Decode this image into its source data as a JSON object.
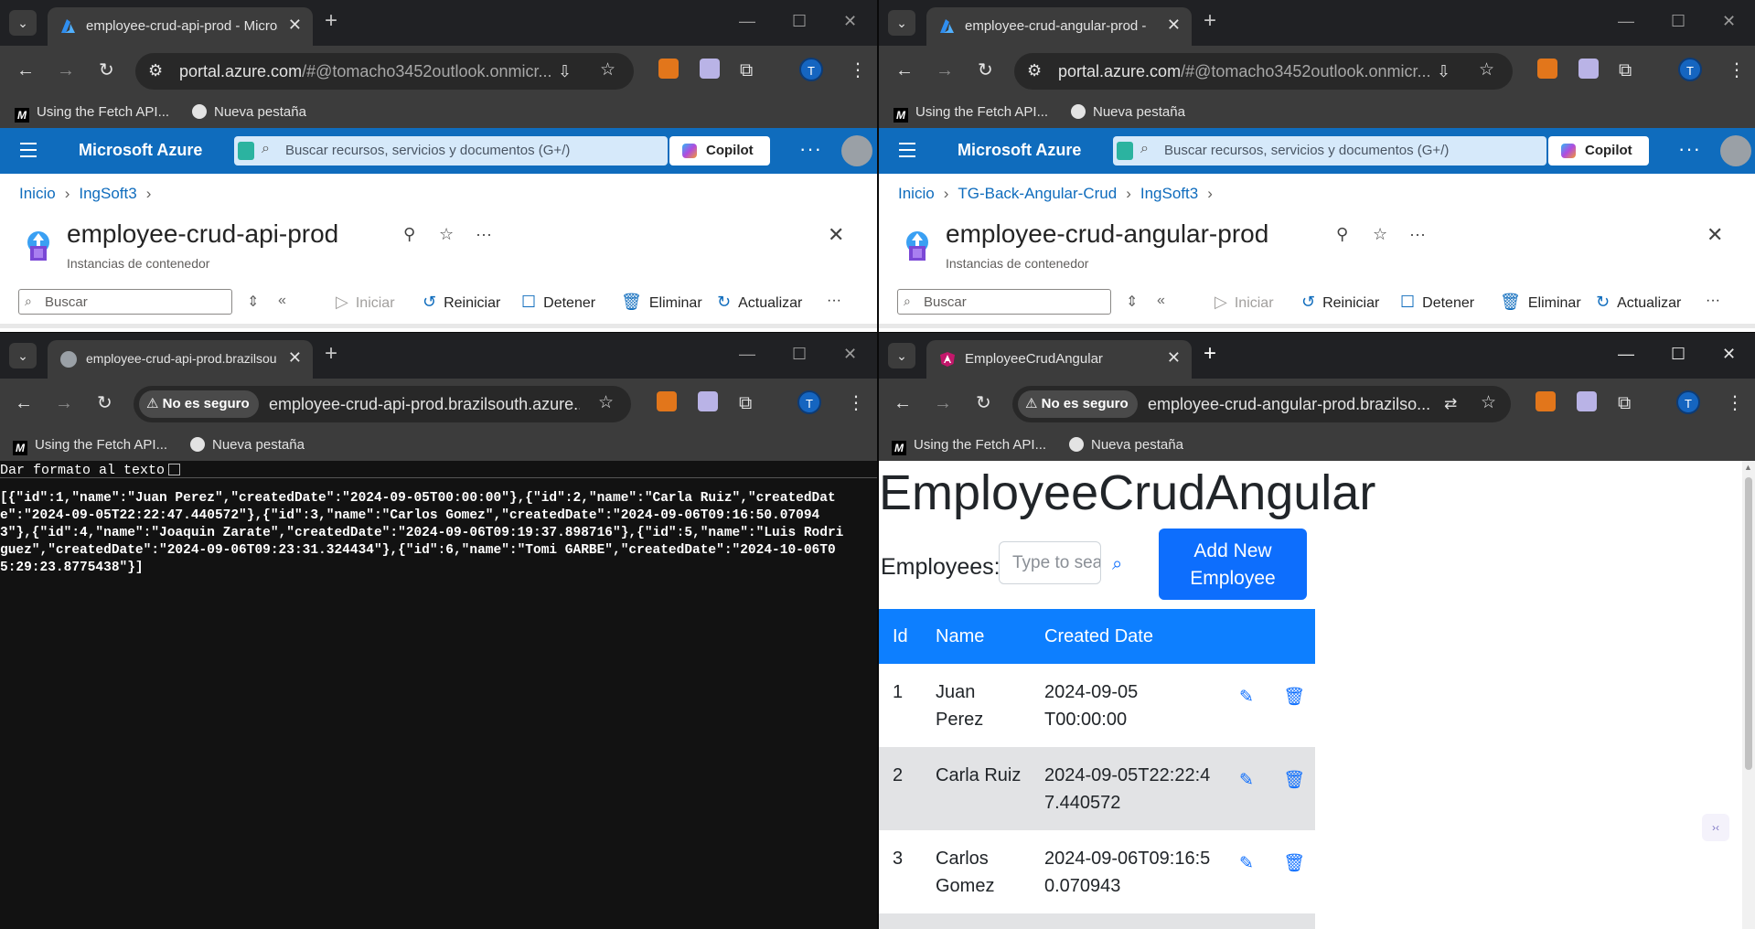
{
  "windows": {
    "w1": {
      "tab_title": "employee-crud-api-prod - Microsoft Azure",
      "url_domain": "portal.azure.com",
      "url_rest": "/#@tomacho3452outlook.onmicr...",
      "bookmarks": [
        "Using the Fetch API...",
        "Nueva pestaña"
      ],
      "avatar": "T",
      "azure": {
        "brand": "Microsoft Azure",
        "search_placeholder": "Buscar recursos, servicios y documentos (G+/)",
        "copilot": "Copilot",
        "breadcrumb": [
          "Inicio",
          "IngSoft3"
        ],
        "title": "employee-crud-api-prod",
        "subtitle": "Instancias de contenedor",
        "cmd_search": "Buscar",
        "commands": [
          "Iniciar",
          "Reiniciar",
          "Detener",
          "Eliminar",
          "Actualizar"
        ]
      }
    },
    "w2": {
      "tab_title": "employee-crud-angular-prod - Microsoft Azure",
      "url_domain": "portal.azure.com",
      "url_rest": "/#@tomacho3452outlook.onmicr...",
      "bookmarks": [
        "Using the Fetch API...",
        "Nueva pestaña"
      ],
      "avatar": "T",
      "azure": {
        "brand": "Microsoft Azure",
        "search_placeholder": "Buscar recursos, servicios y documentos (G+/)",
        "copilot": "Copilot",
        "breadcrumb": [
          "Inicio",
          "TG-Back-Angular-Crud",
          "IngSoft3"
        ],
        "title": "employee-crud-angular-prod",
        "subtitle": "Instancias de contenedor",
        "cmd_search": "Buscar",
        "commands": [
          "Iniciar",
          "Reiniciar",
          "Detener",
          "Eliminar",
          "Actualizar"
        ]
      }
    },
    "w3": {
      "tab_title": "employee-crud-api-prod.brazilsouth.azurecontainer.io",
      "not_secure": "No es seguro",
      "url": "employee-crud-api-prod.brazilsouth.azure...",
      "bookmarks": [
        "Using the Fetch API...",
        "Nueva pestaña"
      ],
      "avatar": "T",
      "pretty_print": "Dar formato al texto",
      "json": "[{\"id\":1,\"name\":\"Juan Perez\",\"createdDate\":\"2024-09-05T00:00:00\"},{\"id\":2,\"name\":\"Carla Ruiz\",\"createdDate\":\"2024-09-05T22:22:47.440572\"},{\"id\":3,\"name\":\"Carlos Gomez\",\"createdDate\":\"2024-09-06T09:16:50.070943\"},{\"id\":4,\"name\":\"Joaquin Zarate\",\"createdDate\":\"2024-09-06T09:19:37.898716\"},{\"id\":5,\"name\":\"Luis Rodriguez\",\"createdDate\":\"2024-09-06T09:23:31.324434\"},{\"id\":6,\"name\":\"Tomi GARBE\",\"createdDate\":\"2024-10-06T05:29:23.8775438\"}]"
    },
    "w4": {
      "tab_title": "EmployeeCrudAngular",
      "not_secure": "No es seguro",
      "url": "employee-crud-angular-prod.brazilso...",
      "bookmarks": [
        "Using the Fetch API...",
        "Nueva pestaña"
      ],
      "avatar": "T",
      "app": {
        "heading": "EmployeeCrudAngular",
        "employees_label": "Employees:",
        "search_placeholder": "Type to search",
        "add_button": "Add New Employee",
        "columns": [
          "Id",
          "Name",
          "Created Date"
        ],
        "rows": [
          {
            "id": "1",
            "name": "Juan Perez",
            "date": "2024-09-05T00:00:00"
          },
          {
            "id": "2",
            "name": "Carla Ruiz",
            "date": "2024-09-05T22:22:47.440572"
          },
          {
            "id": "3",
            "name": "Carlos Gomez",
            "date": "2024-09-06T09:16:50.070943"
          }
        ]
      }
    }
  },
  "colors": {
    "azure_blue": "#0f6cbd",
    "bootstrap_primary": "#0d6efd",
    "chrome_dark": "#202124",
    "chrome_toolbar": "#3c3c3c"
  }
}
